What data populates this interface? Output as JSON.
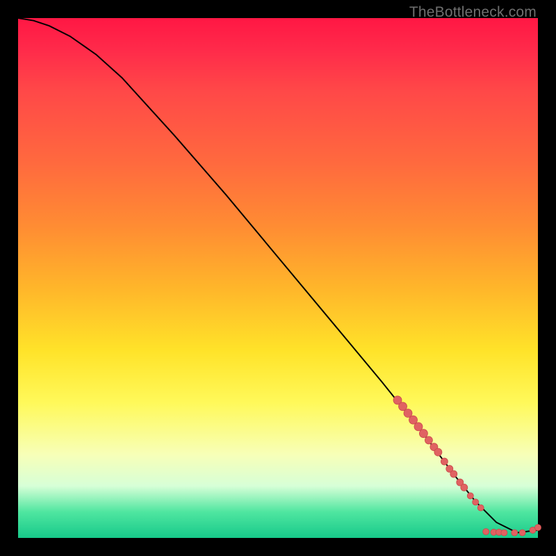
{
  "watermark": "TheBottleneck.com",
  "colors": {
    "curve_stroke": "#000000",
    "marker_fill": "#e06262",
    "marker_stroke": "#c94a4a"
  },
  "chart_data": {
    "type": "line",
    "title": "",
    "xlabel": "",
    "ylabel": "",
    "xlim": [
      0,
      100
    ],
    "ylim": [
      0,
      100
    ],
    "series": [
      {
        "name": "curve",
        "x": [
          0,
          3,
          6,
          10,
          15,
          20,
          30,
          40,
          50,
          60,
          70,
          78,
          84,
          88,
          92,
          96,
          100
        ],
        "y": [
          100,
          99.5,
          98.5,
          96.5,
          93,
          88.5,
          77.5,
          66,
          54,
          42,
          30,
          20,
          12,
          7,
          3,
          1,
          1.5
        ]
      }
    ],
    "markers": [
      {
        "x": 73,
        "y": 26.5,
        "r": 6
      },
      {
        "x": 74,
        "y": 25.3,
        "r": 6
      },
      {
        "x": 75,
        "y": 24.0,
        "r": 6
      },
      {
        "x": 76,
        "y": 22.7,
        "r": 6
      },
      {
        "x": 77,
        "y": 21.4,
        "r": 6
      },
      {
        "x": 78,
        "y": 20.1,
        "r": 6
      },
      {
        "x": 79,
        "y": 18.8,
        "r": 5.5
      },
      {
        "x": 80,
        "y": 17.5,
        "r": 5.5
      },
      {
        "x": 80.8,
        "y": 16.5,
        "r": 5.5
      },
      {
        "x": 82.0,
        "y": 14.7,
        "r": 5
      },
      {
        "x": 83.0,
        "y": 13.3,
        "r": 5
      },
      {
        "x": 83.8,
        "y": 12.3,
        "r": 5
      },
      {
        "x": 85.0,
        "y": 10.7,
        "r": 5
      },
      {
        "x": 85.8,
        "y": 9.7,
        "r": 5
      },
      {
        "x": 87.0,
        "y": 8.1,
        "r": 4.5
      },
      {
        "x": 88.0,
        "y": 6.9,
        "r": 4.5
      },
      {
        "x": 89.0,
        "y": 5.8,
        "r": 4.5
      },
      {
        "x": 90.0,
        "y": 1.2,
        "r": 4.5
      },
      {
        "x": 91.5,
        "y": 1.1,
        "r": 4.5
      },
      {
        "x": 92.5,
        "y": 1.1,
        "r": 4.5
      },
      {
        "x": 93.5,
        "y": 1.0,
        "r": 4.5
      },
      {
        "x": 95.5,
        "y": 1.0,
        "r": 4.5
      },
      {
        "x": 97.0,
        "y": 1.0,
        "r": 4.5
      },
      {
        "x": 99.0,
        "y": 1.5,
        "r": 4.5
      },
      {
        "x": 100,
        "y": 2.0,
        "r": 4.5
      }
    ]
  }
}
